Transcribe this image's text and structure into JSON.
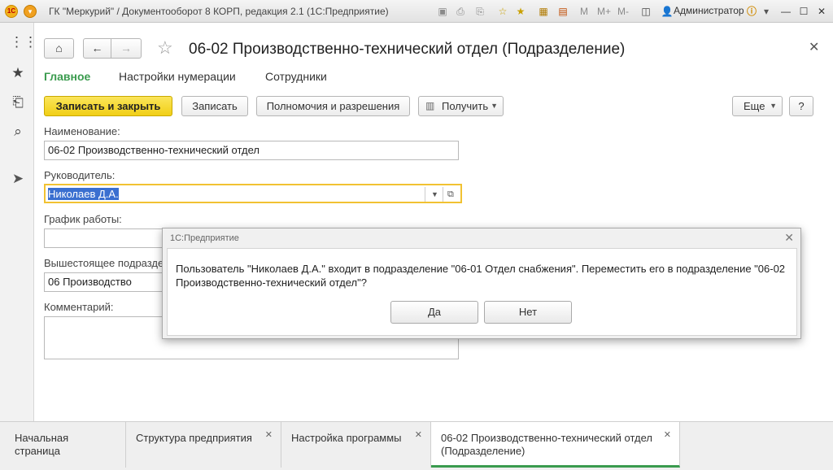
{
  "window": {
    "title": "ГК \"Меркурий\" / Документооборот 8 КОРП, редакция 2.1  (1С:Предприятие)",
    "logo_text": "1С",
    "user": "Администратор"
  },
  "form": {
    "title": "06-02 Производственно-технический отдел (Подразделение)",
    "tabs": [
      {
        "label": "Главное"
      },
      {
        "label": "Настройки нумерации"
      },
      {
        "label": "Сотрудники"
      }
    ],
    "toolbar": {
      "save_close": "Записать и закрыть",
      "save": "Записать",
      "permissions": "Полномочия и разрешения",
      "get": "Получить",
      "more": "Еще",
      "help": "?"
    },
    "fields": {
      "name_label": "Наименование:",
      "name_value": "06-02 Производственно-технический отдел",
      "head_label": "Руководитель:",
      "head_value": "Николаев Д.А.",
      "schedule_label": "График работы:",
      "schedule_value": "",
      "parent_label": "Вышестоящее подразделение:",
      "parent_value": "06 Производство",
      "comment_label": "Комментарий:",
      "comment_value": ""
    }
  },
  "dialog": {
    "title": "1С:Предприятие",
    "message": "Пользователь \"Николаев Д.А.\" входит в подразделение \"06-01 Отдел снабжения\". Переместить его в подразделение \"06-02 Производственно-технический отдел\"?",
    "yes": "Да",
    "no": "Нет"
  },
  "bottom_tabs": [
    {
      "label": "Начальная страница"
    },
    {
      "label": "Структура предприятия"
    },
    {
      "label": "Настройка программы"
    },
    {
      "label": "06-02 Производственно-технический отдел (Подразделение)"
    }
  ],
  "colors": {
    "accent_green": "#3a9b4e",
    "primary_yellow": "#f1cf16",
    "focus_border": "#f1c232",
    "selection": "#3a6fd0"
  }
}
